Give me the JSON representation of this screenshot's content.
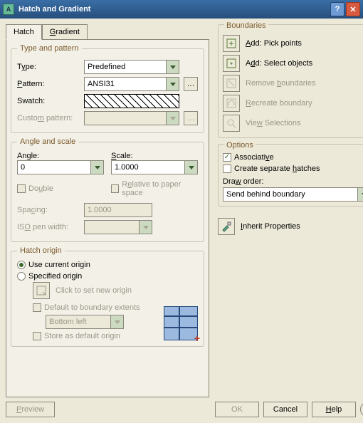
{
  "window": {
    "title": "Hatch and Gradient"
  },
  "tabs": {
    "hatch": "Hatch",
    "gradient": "Gradient",
    "active": "hatch"
  },
  "type_pattern": {
    "legend": "Type and pattern",
    "type_label": "Type:",
    "type_value": "Predefined",
    "pattern_label": "Pattern:",
    "pattern_value": "ANSI31",
    "swatch_label": "Swatch:",
    "custom_label": "Custom pattern:",
    "custom_value": ""
  },
  "angle_scale": {
    "legend": "Angle and scale",
    "angle_label": "Angle:",
    "angle_value": "0",
    "scale_label": "Scale:",
    "scale_value": "1.0000",
    "double_label": "Double",
    "relative_label": "Relative to paper space",
    "spacing_label": "Spacing:",
    "spacing_value": "1.0000",
    "iso_label": "ISO pen width:",
    "iso_value": ""
  },
  "hatch_origin": {
    "legend": "Hatch origin",
    "use_current": "Use current origin",
    "specified": "Specified origin",
    "click_set": "Click to set new origin",
    "default_extents": "Default to boundary extents",
    "corner_value": "Bottom left",
    "store_default": "Store as default origin"
  },
  "boundaries": {
    "heading": "Boundaries",
    "pick": "Add: Pick points",
    "select": "Add: Select objects",
    "remove": "Remove boundaries",
    "recreate": "Recreate boundary",
    "view": "View Selections"
  },
  "options": {
    "heading": "Options",
    "associative": "Associative",
    "separate": "Create separate hatches",
    "draw_order_label": "Draw order:",
    "draw_order_value": "Send behind boundary"
  },
  "inherit": "Inherit Properties",
  "footer": {
    "preview": "Preview",
    "ok": "OK",
    "cancel": "Cancel",
    "help": "Help"
  }
}
